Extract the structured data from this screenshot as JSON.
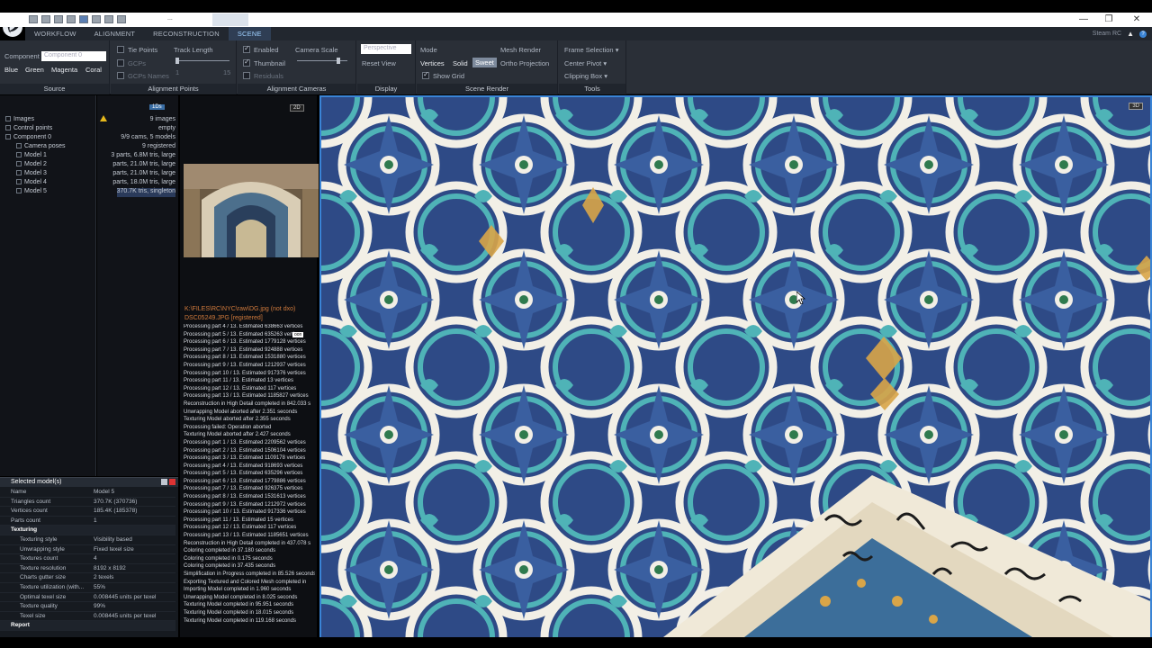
{
  "window": {
    "doc_tab": "...",
    "controls": [
      "—",
      "❐",
      "✕"
    ]
  },
  "menu": {
    "tabs": [
      "WORKFLOW",
      "ALIGNMENT",
      "RECONSTRUCTION",
      "SCENE"
    ],
    "active": "SCENE",
    "account": "Steam RC"
  },
  "ribbon": {
    "source": {
      "title": "Source",
      "component_label": "Component",
      "component_value": "Component 0",
      "colors": [
        "Blue",
        "Green",
        "Magenta",
        "Coral"
      ]
    },
    "alignment_points": {
      "title": "Alignment Points",
      "tie_points": "Tie Points",
      "gcps": "GCPs",
      "gcps_names": "GCPs Names",
      "track_length": "Track Length",
      "min": "1",
      "max": "15"
    },
    "alignment_cameras": {
      "title": "Alignment Cameras",
      "enabled": "Enabled",
      "thumbnail": "Thumbnail",
      "residuals": "Residuals"
    },
    "display": {
      "title": "Display",
      "camera_scale": "Camera Scale",
      "projection": "Perspective",
      "reset_view": "Reset View"
    },
    "scene_render": {
      "title": "Scene Render",
      "mode": "Mode",
      "vertices": "Vertices",
      "solid": "Solid",
      "sweet": "Sweet",
      "show_grid": "Show Grid",
      "mesh_render": "Mesh Render",
      "ortho_projection": "Ortho Projection"
    },
    "tools": {
      "title": "Tools",
      "frame_selection": "Frame Selection",
      "center_pivot": "Center Pivot",
      "clipping_box": "Clipping Box"
    }
  },
  "tree": {
    "badge": "1Ds",
    "items": [
      {
        "label": "Images",
        "value": "9 images"
      },
      {
        "label": "Control points",
        "value": "empty"
      },
      {
        "label": "Component 0",
        "value": "9/9 cams, 5 models"
      },
      {
        "label": "Camera poses",
        "value": "9 registered"
      },
      {
        "label": "Model 1",
        "value": "3 parts, 6.8M tris, large"
      },
      {
        "label": "Model 2",
        "value": "parts, 21.0M tris, large"
      },
      {
        "label": "Model 3",
        "value": "parts, 21.0M tris, large"
      },
      {
        "label": "Model 4",
        "value": "parts, 18.0M tris, large"
      },
      {
        "label": "Model 5",
        "value": "370.7K tris, singleton"
      }
    ]
  },
  "selected": {
    "title": "Selected model(s)",
    "rows": [
      {
        "k": "Name",
        "v": "Model 5"
      },
      {
        "k": "Triangles count",
        "v": "370.7K (370736)"
      },
      {
        "k": "Vertices count",
        "v": "185.4K (185378)"
      },
      {
        "k": "Parts count",
        "v": "1"
      },
      {
        "k": "Texturing",
        "v": "",
        "section": true
      },
      {
        "k": "Texturing style",
        "v": "Visibility based",
        "indent": true
      },
      {
        "k": "Unwrapping style",
        "v": "Fixed texel size",
        "indent": true
      },
      {
        "k": "Textures count",
        "v": "4",
        "indent": true
      },
      {
        "k": "Texture resolution",
        "v": "8192 x 8192",
        "indent": true
      },
      {
        "k": "Charts gutter size",
        "v": "2 texels",
        "indent": true
      },
      {
        "k": "Texture utilization (with...",
        "v": "55%",
        "indent": true
      },
      {
        "k": "Optimal texel size",
        "v": "0.008445 units per texel",
        "indent": true
      },
      {
        "k": "Texture quality",
        "v": "99%",
        "indent": true
      },
      {
        "k": "Texel size",
        "v": "0.008445 units per texel",
        "indent": true
      },
      {
        "k": "Report",
        "v": "",
        "section": true
      }
    ]
  },
  "preview": {
    "mode_2d": "2D",
    "path_line1": "K:\\FILES\\RC\\NYC\\raw\\DG.jpg (not dxo)",
    "path_line2": "DSC05249.JPG [registered]",
    "badge": "oon"
  },
  "log": [
    "Processing part 4 / 13. Estimated 638663 vertices",
    "Processing part 5 / 13. Estimated 635263 vertices",
    "Processing part 6 / 13. Estimated 1779128 vertices",
    "Processing part 7 / 13. Estimated 924888 vertices",
    "Processing part 8 / 13. Estimated 1531880 vertices",
    "Processing part 9 / 13. Estimated 1212937 vertices",
    "Processing part 10 / 13. Estimated 917376 vertices",
    "Processing part 11 / 13. Estimated 13 vertices",
    "Processing part 12 / 13. Estimated 117 vertices",
    "Processing part 13 / 13. Estimated 1185827 vertices",
    "Reconstruction in High Detail completed in 842.033 s",
    "Unwrapping Model aborted after 2.351 seconds",
    "Texturing Model aborted after 2.355 seconds",
    "Processing failed: Operation aborted",
    "Texturing Model aborted after 2.427 seconds",
    "Processing part 1 / 13. Estimated 2209562 vertices",
    "Processing part 2 / 13. Estimated 1506104 vertices",
    "Processing part 3 / 13. Estimated 1109178 vertices",
    "Processing part 4 / 13. Estimated 918693 vertices",
    "Processing part 5 / 13. Estimated 635296 vertices",
    "Processing part 6 / 13. Estimated 1779886 vertices",
    "Processing part 7 / 13. Estimated 926375 vertices",
    "Processing part 8 / 13. Estimated 1531613 vertices",
    "Processing part 9 / 13. Estimated 1212972 vertices",
    "Processing part 10 / 13. Estimated 917336 vertices",
    "Processing part 11 / 13. Estimated 15 vertices",
    "Processing part 12 / 13. Estimated 117 vertices",
    "Processing part 13 / 13. Estimated 1185651 vertices",
    "Reconstruction in High Detail completed in 437.078 s",
    "Coloring completed in 37.180 seconds",
    "Coloring completed in 0.175 seconds",
    "Coloring completed in 37.435 seconds",
    "Simplification in Progress completed in 85.526 seconds",
    "Exporting Textured and Colored Mesh completed in",
    "Importing Model completed in 1.960 seconds",
    "Unwrapping Model completed in 8.025 seconds",
    "Texturing Model completed in 95.951 seconds",
    "Texturing Model completed in 18.015 seconds",
    "Texturing Model completed in 119.168 seconds"
  ],
  "viewport": {
    "mode_3d": "3D"
  },
  "colors": {
    "accent": "#3a84d6",
    "ribbon": "#2a2f37",
    "panel": "#111318",
    "tile_blue": "#2e4a86",
    "tile_turquoise": "#4fb3b7",
    "tile_white": "#f2efe6",
    "tile_gold": "#d9a548"
  },
  "icons": [
    "app-logo-icon",
    "warning-icon",
    "cursor-icon",
    "close-icon",
    "pin-icon"
  ]
}
